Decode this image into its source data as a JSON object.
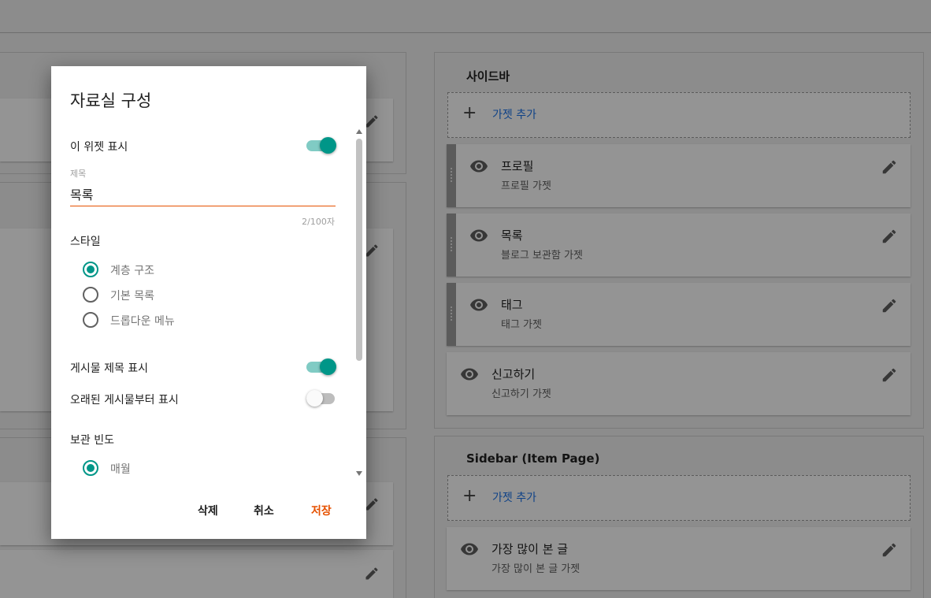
{
  "dialog": {
    "title": "자료실 구성",
    "show_widget_label": "이 위젯 표시",
    "show_widget_on": true,
    "title_field": {
      "label": "제목",
      "value": "목록",
      "counter": "2/100자"
    },
    "style_label": "스타일",
    "style_options": [
      {
        "label": "계층 구조",
        "checked": true
      },
      {
        "label": "기본 목록",
        "checked": false
      },
      {
        "label": "드롭다운 메뉴",
        "checked": false
      }
    ],
    "show_post_titles_label": "게시물 제목 표시",
    "show_post_titles_on": true,
    "show_oldest_first_label": "오래된 게시물부터 표시",
    "show_oldest_first_on": false,
    "frequency_label": "보관 빈도",
    "frequency_options": [
      {
        "label": "매월",
        "checked": true
      }
    ],
    "buttons": {
      "delete": "삭제",
      "cancel": "취소",
      "save": "저장"
    }
  },
  "sidebar": {
    "title": "사이드바",
    "add_gadget": "가젯 추가",
    "gadgets": [
      {
        "name": "프로필",
        "subtitle": "프로필 가젯"
      },
      {
        "name": "목록",
        "subtitle": "블로그 보관함 가젯"
      },
      {
        "name": "태그",
        "subtitle": "태그 가젯"
      },
      {
        "name": "신고하기",
        "subtitle": "신고하기 가젯"
      }
    ]
  },
  "sidebar_item_page": {
    "title": "Sidebar (Item Page)",
    "add_gadget": "가젯 추가",
    "gadgets": [
      {
        "name": "가장 많이 본 글",
        "subtitle": "가장 많이 본 글 가젯"
      }
    ]
  },
  "icons": {
    "edit": "pencil-icon",
    "visibility": "eye-icon",
    "add": "plus-icon",
    "drag": "drag-handle-icon"
  },
  "colors": {
    "accent": "#009688",
    "save": "#e65100",
    "link": "#1a73e8"
  }
}
